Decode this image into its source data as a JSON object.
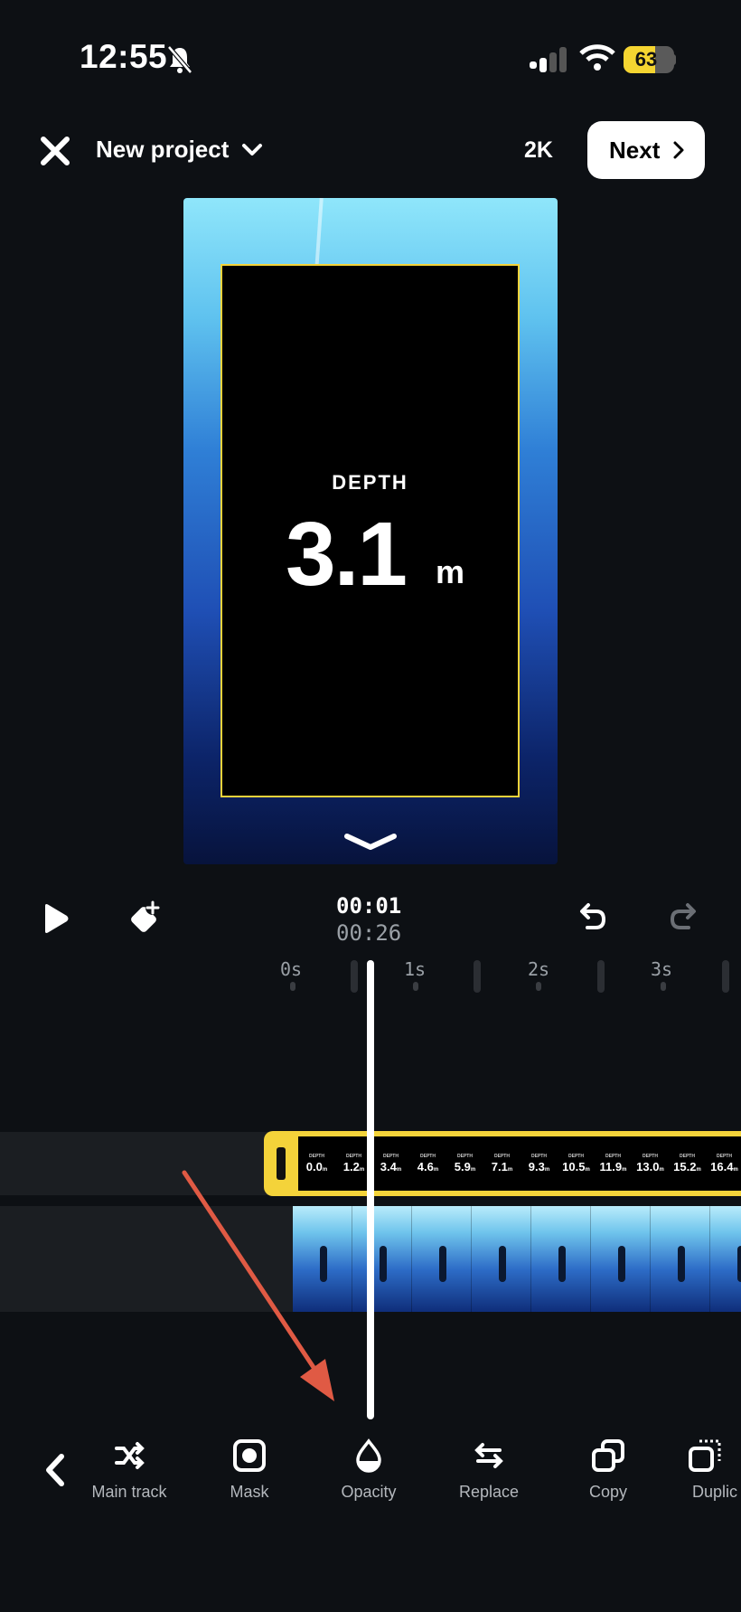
{
  "status_bar": {
    "time": "12:55",
    "battery": "63",
    "battery_level": 0.63
  },
  "top_bar": {
    "close_icon": "close-icon",
    "project_title": "New project",
    "quality": "2K",
    "next_label": "Next"
  },
  "preview": {
    "depth_label": "DEPTH",
    "depth_value": "3.1",
    "depth_unit": "m"
  },
  "playback": {
    "current_time": "00:01",
    "total_time": "00:26"
  },
  "ruler": [
    "0s",
    "1s",
    "2s",
    "3s"
  ],
  "overlay_clip": {
    "values": [
      "0.0",
      "1.2",
      "3.4",
      "4.6",
      "5.9",
      "7.1",
      "9.3",
      "10.5",
      "11.9",
      "13.0",
      "15.2",
      "16.4"
    ],
    "mini_label": "DEPTH",
    "unit": "m"
  },
  "toolbar": {
    "items": [
      {
        "label": "Main track",
        "icon": "shuffle-icon"
      },
      {
        "label": "Mask",
        "icon": "mask-icon"
      },
      {
        "label": "Opacity",
        "icon": "drop-icon"
      },
      {
        "label": "Replace",
        "icon": "swap-icon"
      },
      {
        "label": "Copy",
        "icon": "copy-icon"
      },
      {
        "label": "Duplic",
        "icon": "duplicate-icon"
      }
    ]
  },
  "colors": {
    "accent": "#f4d33a",
    "background": "#0d1014",
    "annotation": "#e05a44"
  }
}
